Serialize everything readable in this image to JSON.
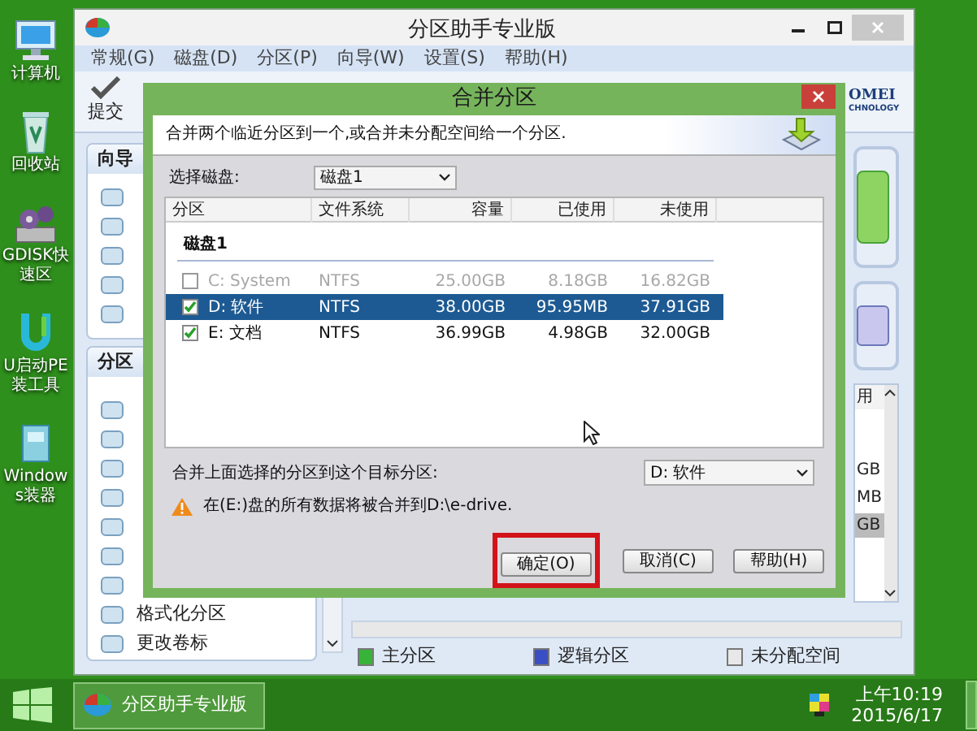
{
  "desktop_icons": [
    {
      "kind": "computer",
      "label": "计算机"
    },
    {
      "kind": "recycle",
      "label": "回收站"
    },
    {
      "kind": "gdisk",
      "label": "GDISK快速区"
    },
    {
      "kind": "upe",
      "label": "U启动PE装工具"
    },
    {
      "kind": "installer",
      "label": "Windows装器"
    }
  ],
  "app_window": {
    "title": "分区助手专业版",
    "menu": [
      "常规(G)",
      "磁盘(D)",
      "分区(P)",
      "向导(W)",
      "设置(S)",
      "帮助(H)"
    ],
    "toolbar": [
      {
        "label": "提交"
      }
    ],
    "logo": [
      "OMEI",
      "CHNOLOGY"
    ],
    "sidebar": [
      {
        "title": "向导"
      },
      {
        "title": "分区",
        "items": [
          "格式化分区",
          "更改卷标"
        ]
      }
    ],
    "list_fragment": {
      "header": "用",
      "cells": [
        "GB",
        "MB",
        "GB"
      ]
    },
    "legend": [
      {
        "label": "主分区",
        "color": "#38b33a"
      },
      {
        "label": "逻辑分区",
        "color": "#3b4fc4"
      },
      {
        "label": "未分配空间",
        "color": "#e8e8e8"
      }
    ]
  },
  "merge_dialog": {
    "title": "合并分区",
    "description": "合并两个临近分区到一个,或合并未分配空间给一个分区.",
    "disk_label": "选择磁盘:",
    "disk_value": "磁盘1",
    "columns": [
      "分区",
      "文件系统",
      "容量",
      "已使用",
      "未使用"
    ],
    "group": "磁盘1",
    "rows": [
      {
        "partition": "C: System",
        "fs": "NTFS",
        "capacity": "25.00GB",
        "used": "8.18GB",
        "free": "16.82GB",
        "checked": false,
        "disabled": true,
        "selected": false
      },
      {
        "partition": "D: 软件",
        "fs": "NTFS",
        "capacity": "38.00GB",
        "used": "95.95MB",
        "free": "37.91GB",
        "checked": true,
        "disabled": false,
        "selected": true
      },
      {
        "partition": "E: 文档",
        "fs": "NTFS",
        "capacity": "36.99GB",
        "used": "4.98GB",
        "free": "32.00GB",
        "checked": true,
        "disabled": false,
        "selected": false
      }
    ],
    "target_label": "合并上面选择的分区到这个目标分区:",
    "target_value": "D: 软件",
    "warning": "在(E:)盘的所有数据将被合并到D:\\e-drive.",
    "buttons": [
      {
        "label": "确定(O)",
        "highlighted": true
      },
      {
        "label": "取消(C)",
        "highlighted": false
      },
      {
        "label": "帮助(H)",
        "highlighted": false
      }
    ]
  },
  "taskbar": {
    "item": "分区助手专业版",
    "time": "上午10:19",
    "date": "2015/6/17"
  }
}
